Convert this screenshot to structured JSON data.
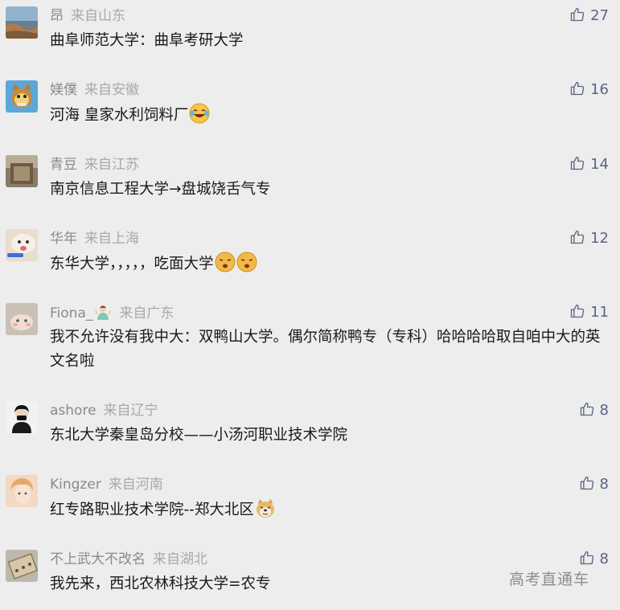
{
  "comments": [
    {
      "user": "昂",
      "location": "来自山东",
      "text": "曲阜师范大学：曲阜考研大学",
      "likes": "27"
    },
    {
      "user": "媄僕",
      "location": "来自安徽",
      "text": "河海 皇家水利饲料厂",
      "likes": "16"
    },
    {
      "user": "青豆",
      "location": "来自江苏",
      "text": "南京信息工程大学→盘城饶舌气专",
      "likes": "14"
    },
    {
      "user": "华年",
      "location": "来自上海",
      "text": "东华大学，，，，，吃面大学",
      "likes": "12"
    },
    {
      "user": "Fiona_",
      "location": "来自广东",
      "text": "我不允许没有我中大：双鸭山大学。偶尔简称鸭专（专科）哈哈哈哈取自咱中大的英文名啦",
      "likes": "11"
    },
    {
      "user": "ashore",
      "location": "来自辽宁",
      "text": "东北大学秦皇岛分校——小汤河职业技术学院",
      "likes": "8"
    },
    {
      "user": "Kingzer",
      "location": "来自河南",
      "text": "红专路职业技术学院--郑大北区",
      "likes": "8"
    },
    {
      "user": "不上武大不改名",
      "location": "来自湖北",
      "text": "我先来，西北农林科技大学=农专",
      "likes": "8"
    }
  ],
  "watermark": "高考直通车"
}
